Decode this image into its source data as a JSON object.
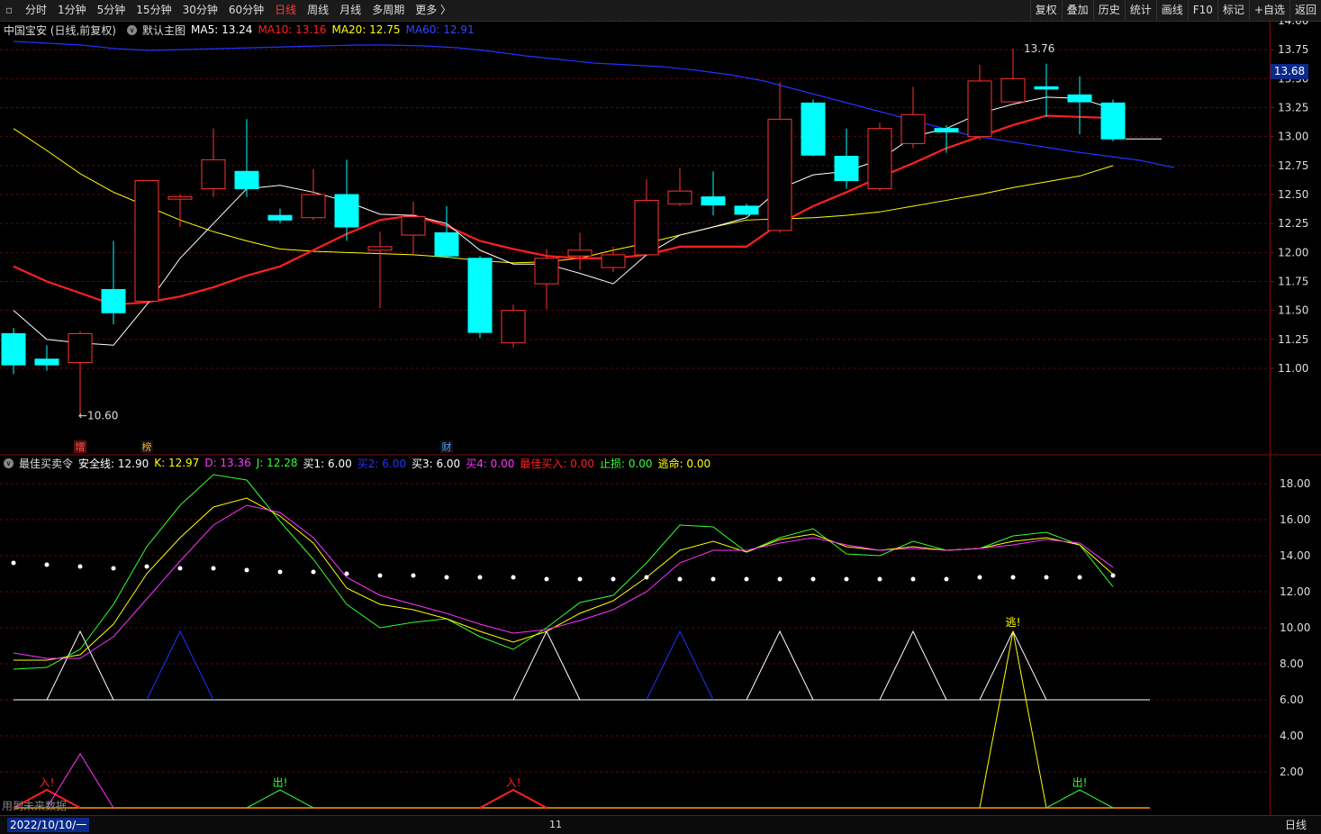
{
  "toolbar": {
    "periods": [
      "分时",
      "1分钟",
      "5分钟",
      "15分钟",
      "30分钟",
      "60分钟",
      "日线",
      "周线",
      "月线",
      "多周期",
      "更多 〉"
    ],
    "active": "日线",
    "right_buttons": [
      "复权",
      "叠加",
      "历史",
      "统计",
      "画线",
      "F10",
      "标记",
      "+自选",
      "返回"
    ]
  },
  "main_info": {
    "stock": "中国宝安 (日线,前复权)",
    "template": "默认主图",
    "ma5": "MA5: 13.24",
    "ma10": "MA10: 13.16",
    "ma20": "MA20: 12.75",
    "ma60": "MA60: 12.91"
  },
  "sub_info": {
    "name": "最佳买卖令",
    "items": [
      {
        "text": "安全线: 12.90",
        "color": "#ffffff"
      },
      {
        "text": "K: 12.97",
        "color": "#ffff00"
      },
      {
        "text": "D: 13.36",
        "color": "#ff33ff"
      },
      {
        "text": "J: 12.28",
        "color": "#33ff33"
      },
      {
        "text": "买1: 6.00",
        "color": "#ffffff"
      },
      {
        "text": "买2: 6.00",
        "color": "#2233ff"
      },
      {
        "text": "买3: 6.00",
        "color": "#ffffff"
      },
      {
        "text": "买4: 0.00",
        "color": "#ff33ff"
      },
      {
        "text": "最佳买入: 0.00",
        "color": "#ff2020"
      },
      {
        "text": "止损: 0.00",
        "color": "#33ff33"
      },
      {
        "text": "逃命: 0.00",
        "color": "#ffff00"
      }
    ]
  },
  "price_axis": {
    "labels": [
      "14.00",
      "13.75",
      "13.50",
      "13.25",
      "13.00",
      "12.75",
      "12.50",
      "12.25",
      "12.00",
      "11.75",
      "11.50",
      "11.25",
      "11.00"
    ],
    "current": "13.68"
  },
  "sub_axis": {
    "labels": [
      "18.00",
      "16.00",
      "14.00",
      "12.00",
      "10.00",
      "8.00",
      "6.00",
      "4.00",
      "2.00"
    ]
  },
  "annotations": {
    "high": "13.76",
    "low": "←10.60",
    "escape": "逃!",
    "buy": "入!",
    "sell": "出!"
  },
  "markers": [
    {
      "text": "增",
      "color": "#ff5555"
    },
    {
      "text": "榜",
      "color": "#ffaa33"
    },
    {
      "text": "财",
      "color": "#5599ff"
    }
  ],
  "bottom": {
    "date": "2022/10/10/一",
    "month": "11",
    "period": "日线",
    "note": "用到未来数据"
  },
  "colors": {
    "up": "#ff3333",
    "down": "#00ffff",
    "ma5": "#ffffff",
    "ma10": "#ff2020",
    "ma20": "#ffff00",
    "ma60": "#2233ff",
    "grid": "#5a0a0a"
  },
  "chart_data": {
    "type": "candlestick",
    "price_range": [
      10.75,
      14.05
    ],
    "candles": [
      {
        "o": 11.3,
        "h": 11.35,
        "l": 10.95,
        "c": 11.03
      },
      {
        "o": 11.08,
        "h": 11.2,
        "l": 10.98,
        "c": 11.03
      },
      {
        "o": 11.05,
        "h": 11.32,
        "l": 10.6,
        "c": 11.3
      },
      {
        "o": 11.68,
        "h": 12.1,
        "l": 11.38,
        "c": 11.48
      },
      {
        "o": 11.58,
        "h": 12.62,
        "l": 11.58,
        "c": 12.62
      },
      {
        "o": 12.46,
        "h": 12.5,
        "l": 12.22,
        "c": 12.48
      },
      {
        "o": 12.55,
        "h": 13.07,
        "l": 12.48,
        "c": 12.8
      },
      {
        "o": 12.7,
        "h": 13.15,
        "l": 12.48,
        "c": 12.55
      },
      {
        "o": 12.32,
        "h": 12.38,
        "l": 12.25,
        "c": 12.28
      },
      {
        "o": 12.3,
        "h": 12.72,
        "l": 12.28,
        "c": 12.5
      },
      {
        "o": 12.5,
        "h": 12.8,
        "l": 12.1,
        "c": 12.22
      },
      {
        "o": 12.02,
        "h": 12.18,
        "l": 11.52,
        "c": 12.05
      },
      {
        "o": 12.15,
        "h": 12.44,
        "l": 11.97,
        "c": 12.31
      },
      {
        "o": 12.17,
        "h": 12.4,
        "l": 11.98,
        "c": 11.97
      },
      {
        "o": 11.95,
        "h": 11.97,
        "l": 11.26,
        "c": 11.31
      },
      {
        "o": 11.22,
        "h": 11.55,
        "l": 11.18,
        "c": 11.5
      },
      {
        "o": 11.73,
        "h": 12.03,
        "l": 11.51,
        "c": 11.95
      },
      {
        "o": 11.97,
        "h": 12.17,
        "l": 11.85,
        "c": 12.02
      },
      {
        "o": 11.87,
        "h": 12.05,
        "l": 11.83,
        "c": 11.98
      },
      {
        "o": 11.98,
        "h": 12.63,
        "l": 11.98,
        "c": 12.45
      },
      {
        "o": 12.42,
        "h": 12.73,
        "l": 12.4,
        "c": 12.53
      },
      {
        "o": 12.48,
        "h": 12.7,
        "l": 12.32,
        "c": 12.41
      },
      {
        "o": 12.4,
        "h": 12.42,
        "l": 12.32,
        "c": 12.33
      },
      {
        "o": 12.19,
        "h": 13.47,
        "l": 12.17,
        "c": 13.15
      },
      {
        "o": 13.29,
        "h": 13.32,
        "l": 12.83,
        "c": 12.84
      },
      {
        "o": 12.83,
        "h": 13.07,
        "l": 12.55,
        "c": 12.62
      },
      {
        "o": 12.55,
        "h": 13.12,
        "l": 12.53,
        "c": 13.07
      },
      {
        "o": 12.94,
        "h": 13.43,
        "l": 12.9,
        "c": 13.19
      },
      {
        "o": 13.07,
        "h": 13.1,
        "l": 12.86,
        "c": 13.04
      },
      {
        "o": 13.0,
        "h": 13.62,
        "l": 12.97,
        "c": 13.48
      },
      {
        "o": 13.3,
        "h": 13.76,
        "l": 13.3,
        "c": 13.5
      },
      {
        "o": 13.43,
        "h": 13.63,
        "l": 13.17,
        "c": 13.41
      },
      {
        "o": 13.36,
        "h": 13.52,
        "l": 13.02,
        "c": 13.3
      },
      {
        "o": 13.29,
        "h": 13.32,
        "l": 12.96,
        "c": 12.98
      }
    ],
    "ma5": [
      11.5,
      11.25,
      11.22,
      11.2,
      11.55,
      11.95,
      12.25,
      12.55,
      12.58,
      12.52,
      12.44,
      12.33,
      12.32,
      12.25,
      12.02,
      11.9,
      11.9,
      11.82,
      11.73,
      11.98,
      12.15,
      12.22,
      12.3,
      12.55,
      12.67,
      12.7,
      12.8,
      13.0,
      13.07,
      13.2,
      13.28,
      13.34,
      13.33,
      13.24
    ],
    "ma10": [
      11.88,
      11.75,
      11.65,
      11.55,
      11.57,
      11.62,
      11.7,
      11.8,
      11.88,
      12.02,
      12.16,
      12.28,
      12.32,
      12.23,
      12.1,
      12.03,
      11.97,
      11.95,
      11.95,
      11.98,
      12.05,
      12.05,
      12.05,
      12.25,
      12.4,
      12.52,
      12.65,
      12.77,
      12.9,
      13.0,
      13.1,
      13.18,
      13.17,
      13.16
    ],
    "ma20": [
      13.07,
      12.88,
      12.68,
      12.52,
      12.4,
      12.28,
      12.18,
      12.1,
      12.03,
      12.01,
      12.0,
      11.99,
      11.98,
      11.96,
      11.93,
      11.91,
      11.92,
      11.95,
      12.02,
      12.08,
      12.15,
      12.22,
      12.28,
      12.29,
      12.3,
      12.32,
      12.35,
      12.4,
      12.45,
      12.5,
      12.56,
      12.61,
      12.66,
      12.75
    ],
    "ma60_y": [
      46,
      48,
      50,
      54,
      56,
      55,
      54,
      53,
      52,
      51,
      50,
      50,
      51,
      53,
      57,
      62,
      66,
      70,
      72,
      74,
      78,
      83,
      90,
      100,
      110,
      120,
      130,
      140,
      150,
      156,
      162,
      168,
      173,
      178,
      186
    ],
    "safety": [
      13.6,
      13.5,
      13.4,
      13.3,
      13.4,
      13.3,
      13.3,
      13.2,
      13.1,
      13.1,
      13.0,
      12.9,
      12.9,
      12.8,
      12.8,
      12.8,
      12.7,
      12.7,
      12.7,
      12.8,
      12.7,
      12.7,
      12.7,
      12.7,
      12.7,
      12.7,
      12.7,
      12.7,
      12.7,
      12.8,
      12.8,
      12.8,
      12.8,
      12.9
    ],
    "K": [
      8.2,
      8.2,
      8.5,
      10.2,
      13.0,
      15.0,
      16.7,
      17.2,
      16.2,
      14.7,
      12.2,
      11.3,
      11.0,
      10.5,
      9.8,
      9.2,
      9.8,
      10.8,
      11.5,
      12.8,
      14.3,
      14.8,
      14.2,
      14.9,
      15.2,
      14.5,
      14.3,
      14.5,
      14.3,
      14.4,
      14.8,
      15.0,
      14.6,
      12.97
    ],
    "D": [
      8.6,
      8.3,
      8.3,
      9.5,
      11.6,
      13.7,
      15.7,
      16.8,
      16.4,
      15.0,
      12.8,
      11.8,
      11.3,
      10.8,
      10.2,
      9.7,
      9.9,
      10.4,
      11.0,
      12.0,
      13.6,
      14.3,
      14.3,
      14.7,
      15.0,
      14.6,
      14.3,
      14.4,
      14.3,
      14.4,
      14.6,
      14.9,
      14.7,
      13.36
    ],
    "J": [
      7.7,
      7.8,
      8.8,
      11.3,
      14.5,
      16.8,
      18.5,
      18.2,
      15.9,
      13.8,
      11.3,
      10.0,
      10.3,
      10.5,
      9.5,
      8.8,
      10.0,
      11.4,
      11.8,
      13.6,
      15.7,
      15.6,
      14.2,
      15.0,
      15.5,
      14.1,
      14.0,
      14.8,
      14.3,
      14.4,
      15.1,
      15.3,
      14.6,
      12.28
    ],
    "buy_triangles": [
      {
        "i": 2,
        "color": "#ffffff"
      },
      {
        "i": 5,
        "color": "#2233ff"
      },
      {
        "i": 16,
        "color": "#ffffff"
      },
      {
        "i": 20,
        "color": "#2233ff"
      },
      {
        "i": 23,
        "color": "#ffffff"
      },
      {
        "i": 27,
        "color": "#ffffff"
      },
      {
        "i": 30,
        "color": "#ffffff"
      }
    ]
  }
}
